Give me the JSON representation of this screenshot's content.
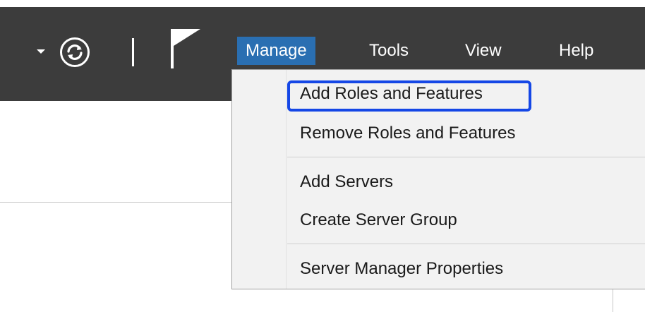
{
  "toolbar": {
    "dropdown_icon": "chevron-down-icon",
    "refresh_icon": "refresh-icon",
    "flag_icon": "notifications-flag-icon"
  },
  "menubar": {
    "items": [
      {
        "label": "Manage",
        "active": true
      },
      {
        "label": "Tools"
      },
      {
        "label": "View"
      },
      {
        "label": "Help"
      }
    ]
  },
  "manage_menu": {
    "items": [
      {
        "label": "Add Roles and Features",
        "highlighted": true
      },
      {
        "label": "Remove Roles and Features"
      },
      {
        "label": "Add Servers"
      },
      {
        "label": "Create Server Group"
      },
      {
        "label": "Server Manager Properties"
      }
    ]
  },
  "colors": {
    "titlebar": "#3c3c3c",
    "active_menu": "#2a6fb2",
    "highlight_border": "#1547e6",
    "menu_background": "#f2f2f2"
  }
}
